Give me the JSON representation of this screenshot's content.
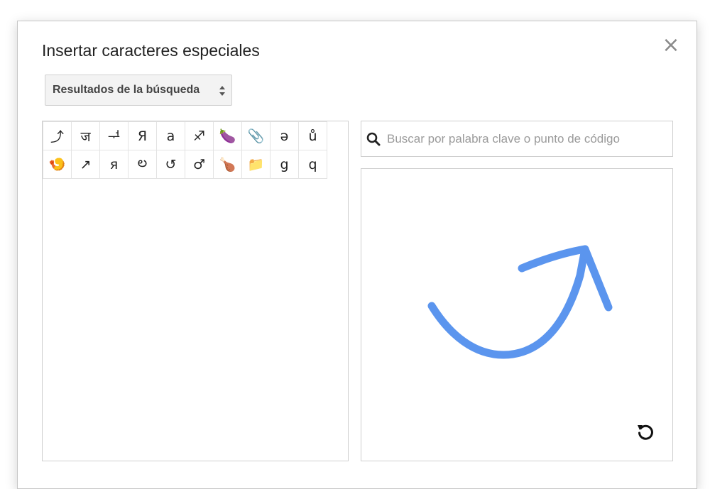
{
  "dialog": {
    "title": "Insertar caracteres especiales",
    "close_icon": "close-icon"
  },
  "category_select": {
    "selected": "Resultados de la búsqueda"
  },
  "results": {
    "characters": [
      "⤴",
      "ज",
      "ᅻ",
      "Я",
      "a",
      "♐",
      "🍆",
      "📎",
      "ə",
      "ů",
      "🍤",
      "↗",
      "я",
      "ల",
      "↺",
      "♂",
      "🍗",
      "📁",
      "g",
      "q"
    ]
  },
  "search": {
    "placeholder": "Buscar por palabra clave o punto de código",
    "value": ""
  },
  "drawing": {
    "stroke_color": "#5b95ee",
    "reset_icon": "reset-icon"
  }
}
